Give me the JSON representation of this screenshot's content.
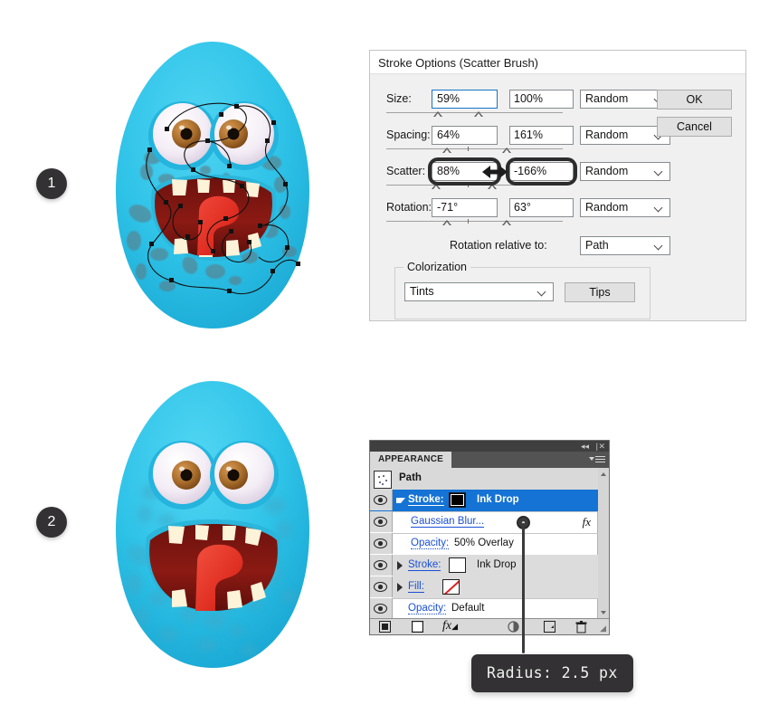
{
  "steps": [
    {
      "number": "1"
    },
    {
      "number": "2"
    }
  ],
  "dialog": {
    "title": "Stroke Options (Scatter Brush)",
    "rows": [
      {
        "label": "Size:",
        "min": "59%",
        "max": "100%",
        "mode": "Random"
      },
      {
        "label": "Spacing:",
        "min": "64%",
        "max": "161%",
        "mode": "Random"
      },
      {
        "label": "Scatter:",
        "min": "88%",
        "max": "-166%",
        "mode": "Random"
      },
      {
        "label": "Rotation:",
        "min": "-71°",
        "max": "63°",
        "mode": "Random"
      }
    ],
    "rotation_relative": {
      "label": "Rotation relative to:",
      "value": "Path"
    },
    "colorization": {
      "title": "Colorization",
      "method": "Tints",
      "tips_label": "Tips"
    },
    "buttons": {
      "ok": "OK",
      "cancel": "Cancel"
    }
  },
  "appearance": {
    "tab_label": "APPEARANCE",
    "object_label": "Path",
    "rows": [
      {
        "label": "Stroke:",
        "value": "Ink Drop",
        "swatch": "black"
      },
      {
        "label": "Gaussian Blur...",
        "value": "",
        "swatch": "none"
      },
      {
        "label": "Opacity:",
        "value": "50% Overlay",
        "swatch": "none"
      },
      {
        "label": "Stroke:",
        "value": "Ink Drop",
        "swatch": "white"
      },
      {
        "label": "Fill:",
        "value": "",
        "swatch": "nofill"
      },
      {
        "label": "Opacity:",
        "value": "Default",
        "swatch": "none"
      }
    ],
    "fx_marker": "fx",
    "bottom_icons": [
      "new-fill-icon",
      "new-stroke-icon",
      "add-effect-icon",
      "clear-appearance-icon",
      "duplicate-item-icon",
      "delete-item-icon"
    ]
  },
  "callout": {
    "tooltip_text": "Radius: 2.5 px"
  },
  "colors": {
    "body_cyan": "#2ec4e8",
    "mouth_dark_red": "#7c1712",
    "tongue_red": "#e8342a",
    "tooth_cream": "#fdf3d8",
    "iris_brown": "#b5762f",
    "badge_dark": "#333133",
    "selection_blue": "#1473d4",
    "link_blue": "#1a4fd6"
  }
}
